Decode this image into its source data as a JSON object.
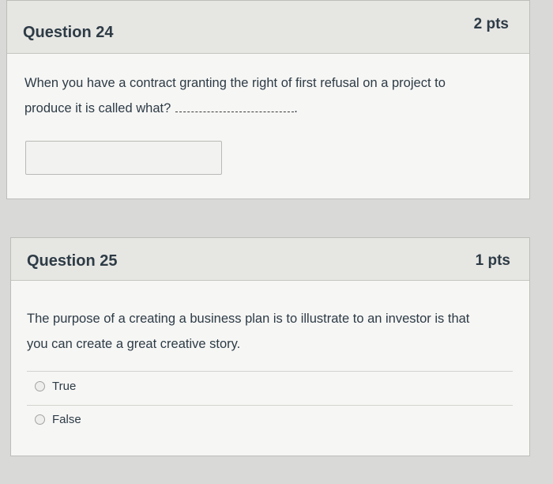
{
  "questions": [
    {
      "title": "Question 24",
      "points": "2 pts",
      "text_line1": "When you have a contract granting the right of first refusal on a project to",
      "text_line2": "produce it is called what?",
      "blank_end": "."
    },
    {
      "title": "Question 25",
      "points": "1 pts",
      "text_line1": "The purpose of a creating a business plan is to illustrate to an investor is that",
      "text_line2": "you can create a great creative story.",
      "options": [
        "True",
        "False"
      ]
    }
  ]
}
